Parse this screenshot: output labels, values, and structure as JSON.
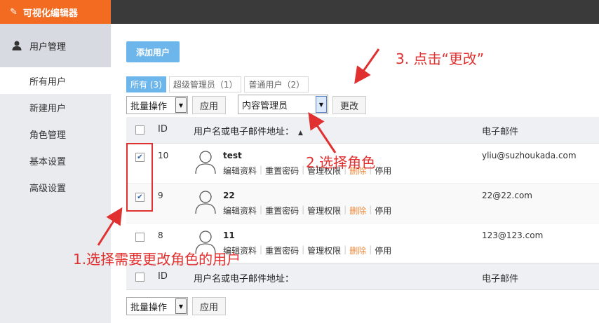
{
  "brand": {
    "title": "可视化编辑器"
  },
  "sidebar": {
    "section": "用户管理",
    "items": [
      {
        "label": "所有用户",
        "active": true
      },
      {
        "label": "新建用户"
      },
      {
        "label": "角色管理"
      },
      {
        "label": "基本设置"
      },
      {
        "label": "高级设置"
      }
    ]
  },
  "main": {
    "add_button": "添加用户",
    "tabs": [
      {
        "label": "所有 (3)",
        "active": true
      },
      {
        "label": "超级管理员（1）"
      },
      {
        "label": "普通用户（2）"
      }
    ],
    "bulk_select": "批量操作",
    "apply_label": "应用",
    "role_select": "内容管理员",
    "change_label": "更改"
  },
  "table": {
    "headers": {
      "id": "ID",
      "name": "用户名或电子邮件地址：",
      "email": "电子邮件"
    },
    "rows": [
      {
        "id": "10",
        "name": "test",
        "email": "yliu@suzhoukada.com",
        "checked": true
      },
      {
        "id": "9",
        "name": "22",
        "email": "22@22.com",
        "checked": true
      },
      {
        "id": "8",
        "name": "11",
        "email": "123@123.com",
        "checked": false
      }
    ],
    "actions": {
      "edit": "编辑资料",
      "reset": "重置密码",
      "perm": "管理权限",
      "delete": "删除",
      "disable": "停用"
    }
  },
  "annotations": {
    "step1": "1.选择需要更改角色的用户",
    "step2": "2.选择角色",
    "step3": "3. 点击“更改”"
  },
  "colors": {
    "brand": "#f26b21",
    "primary": "#6cb6ec",
    "annotation": "#e0302f",
    "delete": "#f08a3a"
  },
  "icons": {
    "brand": "magic-wand-icon",
    "section": "user-icon",
    "avatar": "user-avatar-icon"
  }
}
